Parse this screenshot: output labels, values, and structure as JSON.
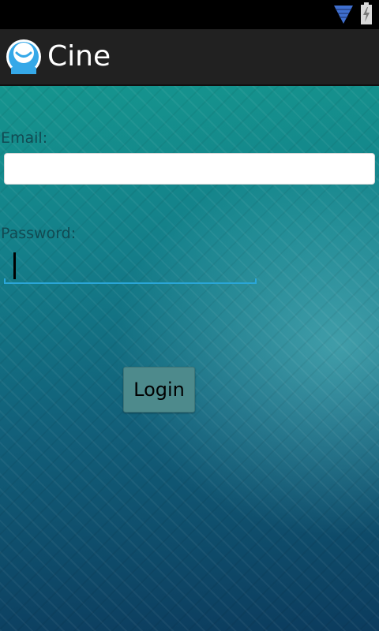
{
  "status_bar": {
    "icons": [
      "wifi-icon",
      "battery-charging-icon"
    ],
    "icon_color": "#3f6fcf"
  },
  "action_bar": {
    "title": "Cine",
    "logo_icon": "smiley-person-icon",
    "logo_color": "#35a8e8"
  },
  "form": {
    "email_label": "Email:",
    "email_value": "",
    "password_label": "Password:",
    "password_value": "",
    "login_label": "Login"
  },
  "colors": {
    "accent": "#2aa6d8",
    "action_bar_bg": "#212121",
    "label_color": "#114a52"
  }
}
